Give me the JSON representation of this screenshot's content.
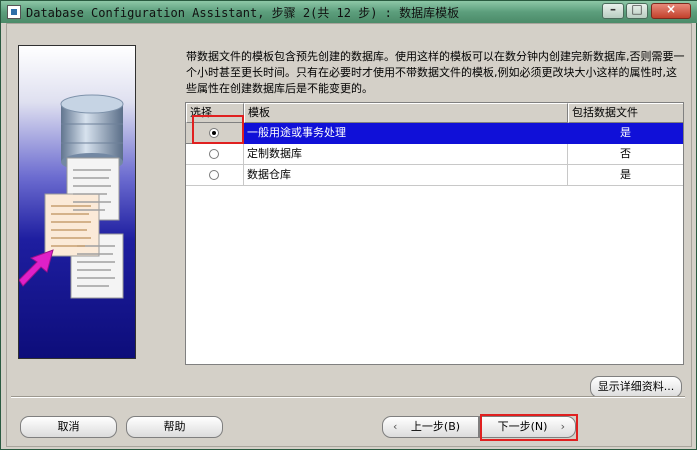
{
  "window": {
    "title": "Database Configuration Assistant, 步骤 2(共 12 步) : 数据库模板"
  },
  "description": "带数据文件的模板包含预先创建的数据库。使用这样的模板可以在数分钟内创建完新数据库,否则需要一个小时甚至更长时间。只有在必要时才使用不带数据文件的模板,例如必须更改块大小这样的属性时,这些属性在创建数据库后是不能变更的。",
  "table": {
    "columns": [
      "选择",
      "模板",
      "包括数据文件"
    ],
    "rows": [
      {
        "template": "一般用途或事务处理",
        "includes_datafiles": "是",
        "selected": true
      },
      {
        "template": "定制数据库",
        "includes_datafiles": "否",
        "selected": false
      },
      {
        "template": "数据仓库",
        "includes_datafiles": "是",
        "selected": false
      }
    ]
  },
  "buttons": {
    "details": "显示详细资料...",
    "cancel": "取消",
    "help": "帮助",
    "back": "上一步(B)",
    "next": "下一步(N)"
  },
  "icons": {
    "back": "chevron-left-icon",
    "next": "chevron-right-icon"
  },
  "colors": {
    "selection": "#1010d8",
    "highlight": "#e02020",
    "titlebar": "#5c9e7c"
  }
}
